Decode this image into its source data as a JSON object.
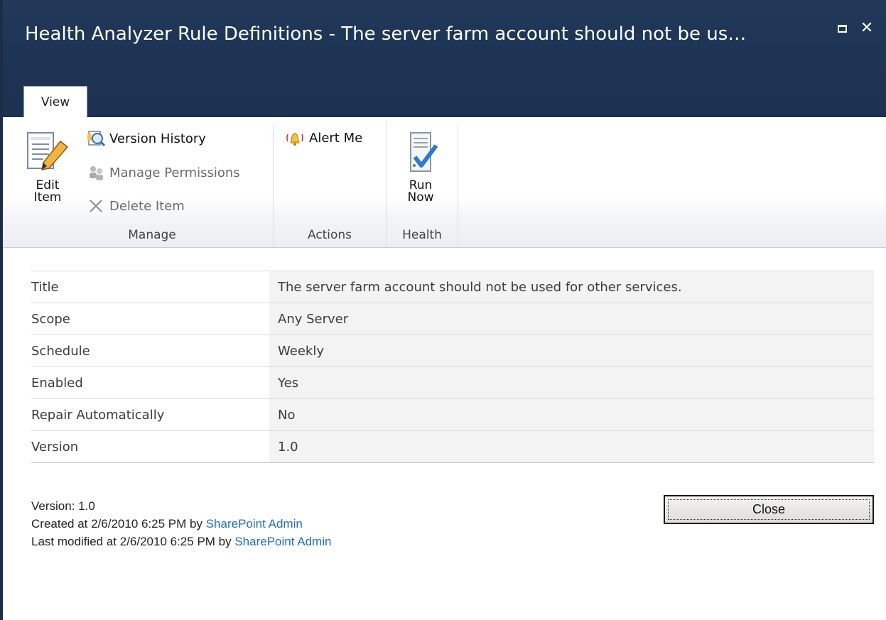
{
  "dialog": {
    "title": "Health Analyzer Rule Definitions - The server farm account should not be us…"
  },
  "ribbon": {
    "tab": "View",
    "manage": {
      "edit_item_line1": "Edit",
      "edit_item_line2": "Item",
      "version_history": "Version History",
      "manage_permissions": "Manage Permissions",
      "delete_item": "Delete Item",
      "group_label": "Manage"
    },
    "actions": {
      "alert_me": "Alert Me",
      "group_label": "Actions"
    },
    "health": {
      "run_now_line1": "Run",
      "run_now_line2": "Now",
      "group_label": "Health"
    }
  },
  "properties": [
    {
      "label": "Title",
      "value": "The server farm account should not be used for other services."
    },
    {
      "label": "Scope",
      "value": "Any Server"
    },
    {
      "label": "Schedule",
      "value": "Weekly"
    },
    {
      "label": "Enabled",
      "value": "Yes"
    },
    {
      "label": "Repair Automatically",
      "value": "No"
    },
    {
      "label": "Version",
      "value": "1.0"
    }
  ],
  "footer": {
    "version_text": "Version: 1.0",
    "created_prefix": "Created at 2/6/2010 6:25 PM by ",
    "created_by": "SharePoint Admin",
    "modified_prefix": "Last modified at 2/6/2010 6:25 PM by ",
    "modified_by": "SharePoint Admin"
  },
  "buttons": {
    "close": "Close"
  },
  "colors": {
    "titlebar": "#1e3455",
    "link": "#1f6fb6",
    "value_bg": "#f3f3f3"
  }
}
